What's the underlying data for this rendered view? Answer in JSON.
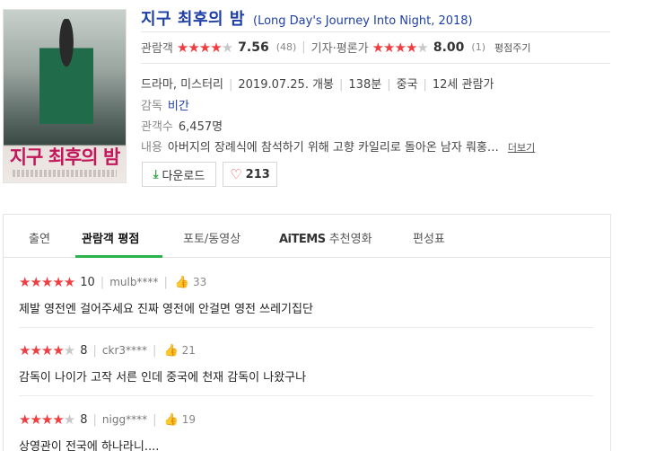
{
  "movie": {
    "title_ko": "지구 최후의 밤",
    "title_en": "(Long Day's Journey Into Night, 2018)",
    "poster_title": "지구 최후의 밤"
  },
  "ratings": {
    "audience_label": "관람객",
    "audience_score": "7.56",
    "audience_count": "(48)",
    "critic_label": "기자·평론가",
    "critic_score": "8.00",
    "critic_count": "(1)",
    "rate_link": "평점주기"
  },
  "info": {
    "genre": "드라마, 미스터리",
    "release": "2019.07.25. 개봉",
    "runtime": "138분",
    "country": "중국",
    "age": "12세 관람가",
    "director_label": "감독",
    "director": "비간",
    "audience_num_label": "관객수",
    "audience_num": "6,457명",
    "summary_label": "내용",
    "summary": "아버지의 장례식에 참석하기 위해 고향 카일리로 돌아온 남자 뤄홍…",
    "more": "더보기"
  },
  "buttons": {
    "download": "다운로드",
    "like_count": "213"
  },
  "tabs": [
    {
      "label": "출연"
    },
    {
      "label": "관람객 평점"
    },
    {
      "label": "포토/동영상"
    },
    {
      "label_ai": "AiTEMS",
      "label": "추천영화"
    },
    {
      "label": "편성표"
    }
  ],
  "reviews": [
    {
      "score": "10",
      "user": "mulb****",
      "likes": "33",
      "text": "제발 영전엔 걸어주세요 진짜 영전에 안걸면 영전 쓰레기집단"
    },
    {
      "score": "8",
      "user": "ckr3****",
      "likes": "21",
      "text": "감독이 나이가 고작 서른 인데 중국에 천재 감독이 나왔구나"
    },
    {
      "score": "8",
      "user": "nigg****",
      "likes": "19",
      "text": "상영관이 전국에 하나라니...."
    }
  ],
  "colors": {
    "star_on": "#ef3e42",
    "star_off": "#c8c8c8",
    "title_blue": "#1e3fa6",
    "tab_active": "#2bb24c"
  }
}
